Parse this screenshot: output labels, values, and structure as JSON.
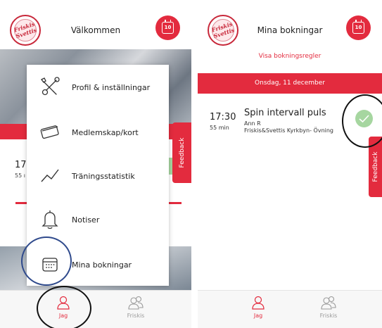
{
  "left": {
    "header_title": "Välkommen",
    "calendar_count": "10",
    "logo_text": "Friskis Svettis",
    "peek_time": "17:",
    "peek_duration": "55 ı",
    "feedback_label": "Feedback",
    "menu": {
      "items": [
        {
          "label": "Profil & inställningar",
          "icon": "wrench-screwdriver-icon"
        },
        {
          "label": "Medlemskap/kort",
          "icon": "membership-card-icon"
        },
        {
          "label": "Träningsstatistik",
          "icon": "statistics-graph-icon"
        },
        {
          "label": "Notiser",
          "icon": "bell-icon"
        },
        {
          "label": "Mina bokningar",
          "icon": "calendar-icon"
        }
      ]
    },
    "tabs": [
      {
        "label": "Jag",
        "icon": "person-icon",
        "active": true
      },
      {
        "label": "Friskis",
        "icon": "group-icon",
        "active": false
      }
    ]
  },
  "right": {
    "header_title": "Mina bokningar",
    "calendar_count": "10",
    "logo_text": "Friskis Svettis",
    "rules_link": "Visa bokningsregler",
    "date_header": "Onsdag, 11 december",
    "booking": {
      "time": "17:30",
      "duration": "55 min",
      "title": "Spin intervall puls",
      "instructor": "Ann R",
      "location": "Friskis&Svettis Kyrkbyn- Övning"
    },
    "feedback_label": "Feedback",
    "tabs": [
      {
        "label": "Jag",
        "icon": "person-icon",
        "active": true
      },
      {
        "label": "Friskis",
        "icon": "group-icon",
        "active": false
      }
    ]
  },
  "colors": {
    "brand_red": "#e32b3e",
    "check_green": "#a6d6a0",
    "inactive_gray": "#9a9a9a",
    "highlight_blue": "#2f4a8c",
    "highlight_black": "#111111"
  }
}
